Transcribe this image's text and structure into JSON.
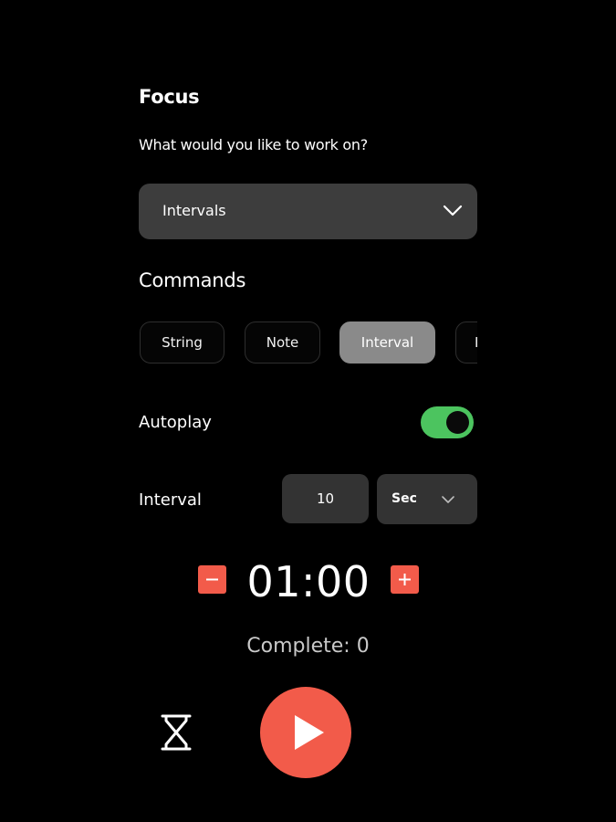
{
  "header": {
    "title": "Focus",
    "prompt": "What would you like to work on?"
  },
  "focus_select": {
    "value": "Intervals",
    "icon": "chevron-down-icon"
  },
  "commands": {
    "label": "Commands",
    "chips": [
      {
        "label": "String",
        "selected": false
      },
      {
        "label": "Note",
        "selected": false
      },
      {
        "label": "Interval",
        "selected": true
      },
      {
        "label": "I",
        "selected": false
      }
    ]
  },
  "autoplay": {
    "label": "Autoplay",
    "enabled": true,
    "color_on": "#4cc45f"
  },
  "interval": {
    "label": "Interval",
    "value": "10",
    "unit": "Sec"
  },
  "timer": {
    "display": "01:00",
    "decrement_icon": "minus-icon",
    "increment_icon": "plus-icon"
  },
  "status": {
    "complete_label": "Complete: 0"
  },
  "controls": {
    "history_icon": "hourglass-icon",
    "play_icon": "play-icon"
  },
  "colors": {
    "accent": "#f25b4a",
    "background": "#000000",
    "surface": "#3d3d3d"
  }
}
